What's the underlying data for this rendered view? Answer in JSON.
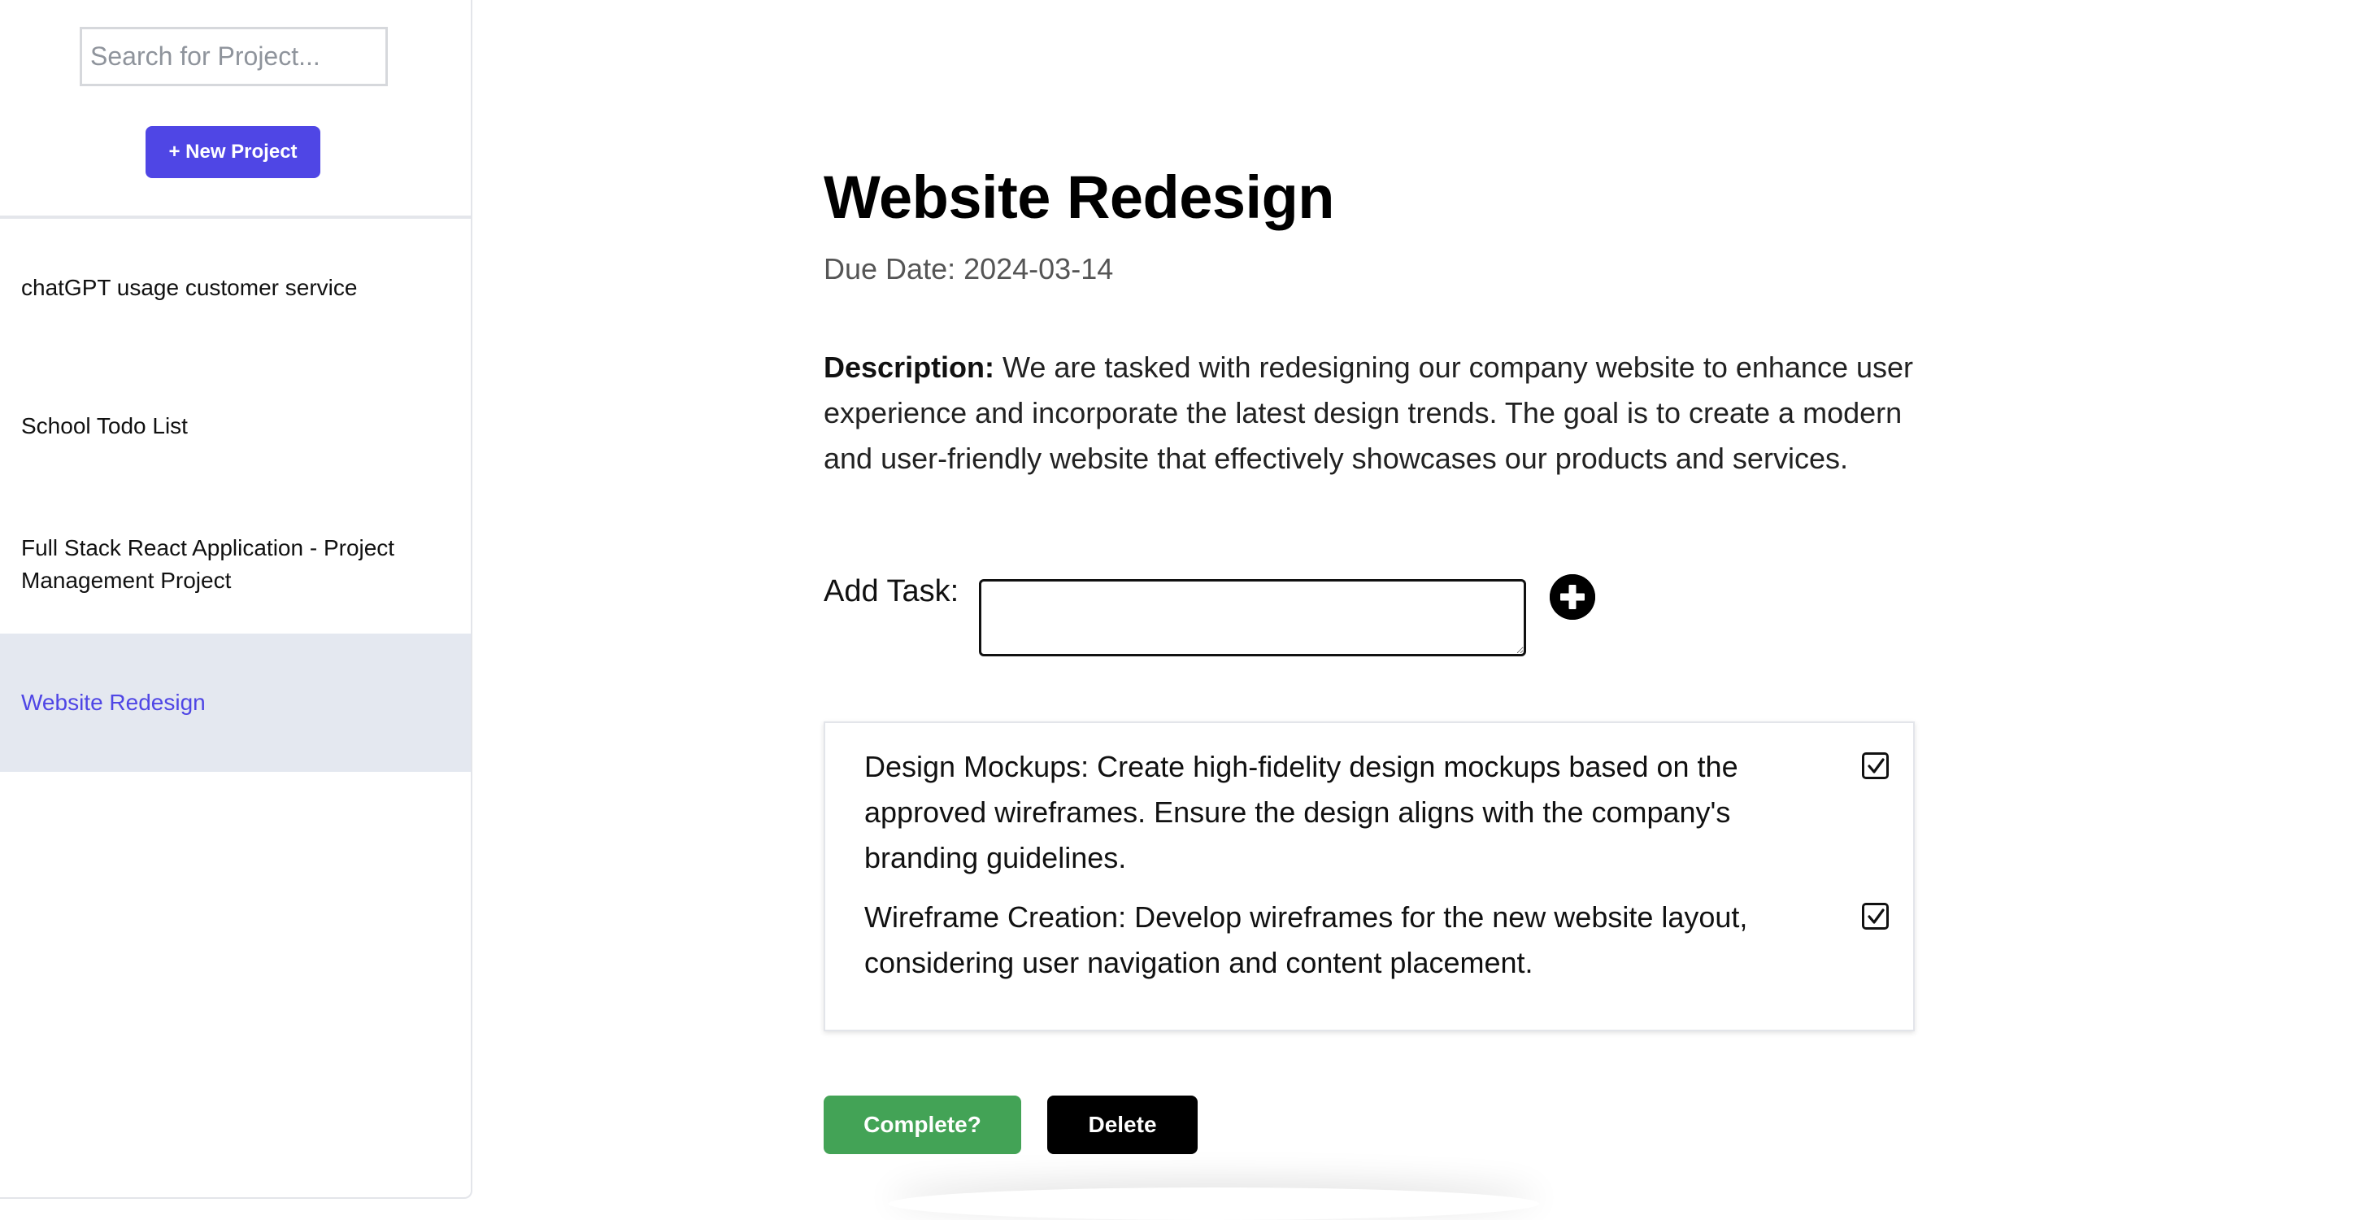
{
  "sidebar": {
    "search_placeholder": "Search for Project...",
    "new_project_label": "+ New Project",
    "projects": [
      {
        "label": "chatGPT usage customer service"
      },
      {
        "label": "School Todo List"
      },
      {
        "label": "Full Stack React Application - Project Management Project"
      },
      {
        "label": "Website Redesign",
        "active": true
      }
    ]
  },
  "project": {
    "title": "Website Redesign",
    "due_date": "Due Date: 2024-03-14",
    "description_label": "Description:",
    "description_text": " We are tasked with redesigning our company website to enhance user experience and incorporate the latest design trends. The goal is to create a modern and user-friendly website that effectively showcases our products and services.",
    "add_task_label": "Add Task:",
    "add_task_value": "",
    "tasks": [
      {
        "text": "Design Mockups: Create high-fidelity design mockups based on the approved wireframes. Ensure the design aligns with the company's branding guidelines.",
        "checked": true
      },
      {
        "text": "Wireframe Creation: Develop wireframes for the new website layout, considering user navigation and content placement.",
        "checked": true
      }
    ],
    "complete_label": "Complete?",
    "delete_label": "Delete"
  },
  "colors": {
    "accent": "#4f46e5",
    "active_item_bg": "#e4e8f0",
    "complete": "#43a356",
    "delete": "#000000"
  },
  "icons": {
    "add_task": "plus-circle-icon",
    "task_check": "checkbox-checked-icon"
  }
}
